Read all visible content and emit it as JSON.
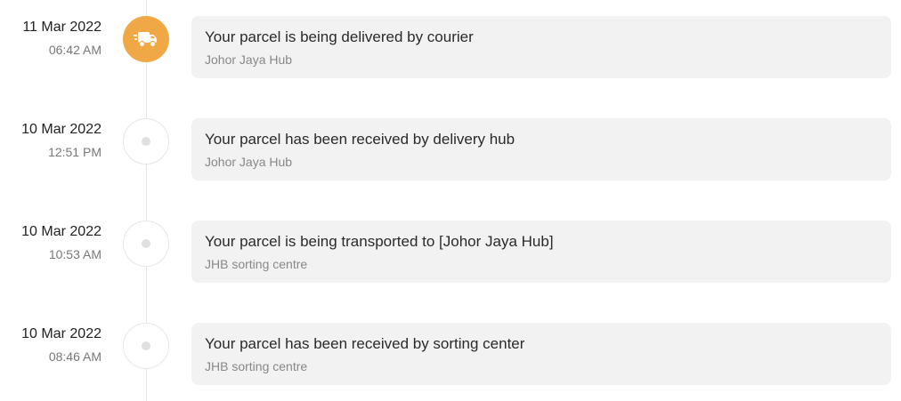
{
  "timeline": {
    "events": [
      {
        "date": "11 Mar 2022",
        "time": "06:42 AM",
        "title": "Your parcel is being delivered by courier",
        "location": "Johor Jaya Hub",
        "status": "active",
        "icon": "delivery-truck-icon"
      },
      {
        "date": "10 Mar 2022",
        "time": "12:51 PM",
        "title": "Your parcel has been received by delivery hub",
        "location": "Johor Jaya Hub",
        "status": "inactive",
        "icon": "dot-icon"
      },
      {
        "date": "10 Mar 2022",
        "time": "10:53 AM",
        "title": "Your parcel is being transported to [Johor Jaya Hub]",
        "location": "JHB sorting centre",
        "status": "inactive",
        "icon": "dot-icon"
      },
      {
        "date": "10 Mar 2022",
        "time": "08:46 AM",
        "title": "Your parcel has been received by sorting center",
        "location": "JHB sorting centre",
        "status": "inactive",
        "icon": "dot-icon"
      }
    ]
  },
  "colors": {
    "accent": "#f0a846",
    "card_background": "#f2f2f2",
    "timeline_line": "#e4e4e4",
    "inactive_dot": "#e0e0e0",
    "muted_text": "#888888"
  }
}
